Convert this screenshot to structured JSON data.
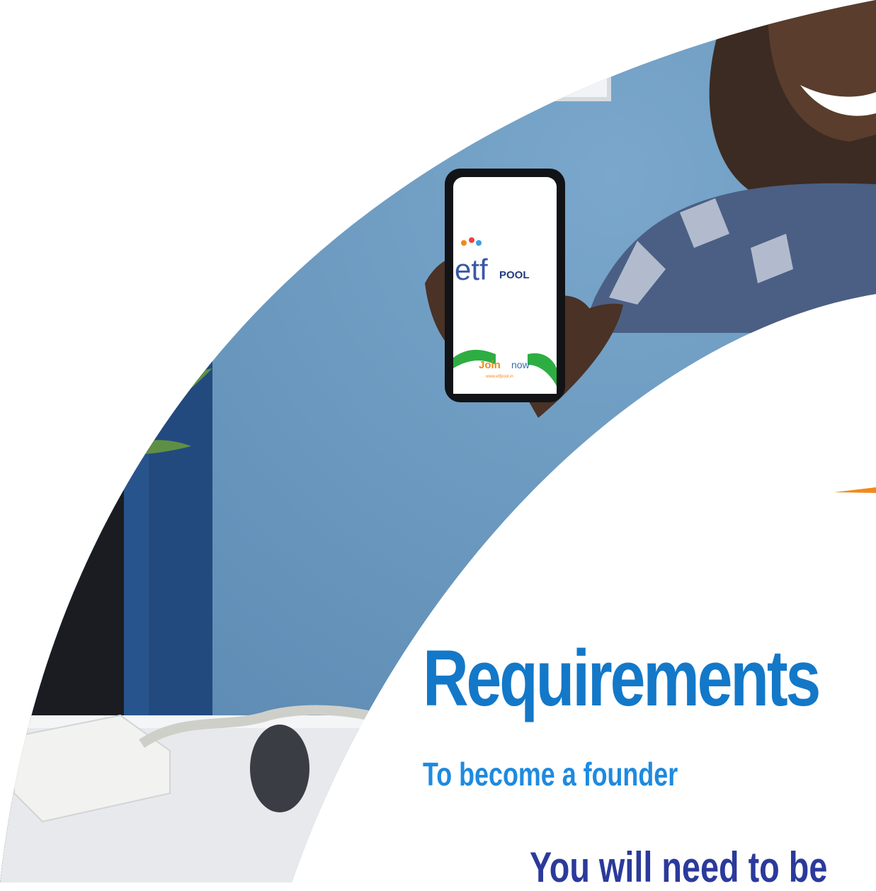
{
  "colors": {
    "wall": "#6a98be",
    "headline": "#1378c8",
    "subhead": "#1e8ae0",
    "intro": "#2b3a9b",
    "accent_orange": "#f08a1c"
  },
  "phone": {
    "brand_prefix": "etf",
    "brand_suffix": "POOL",
    "cta_join": "Join",
    "cta_now": "now",
    "url": "www.etfpool.in"
  },
  "content": {
    "headline": "Requirements",
    "subheadline": "To become a founder",
    "intro": "You will need to be"
  }
}
